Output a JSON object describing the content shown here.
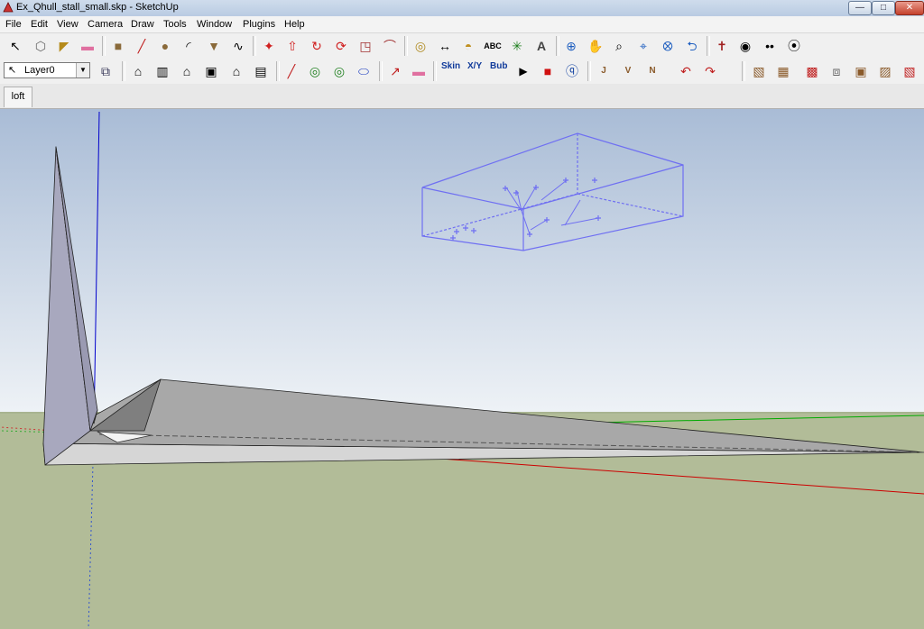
{
  "window": {
    "title": "Ex_Qhull_stall_small.skp - SketchUp",
    "min_glyph": "—",
    "max_glyph": "□",
    "close_glyph": "✕"
  },
  "menu": [
    "File",
    "Edit",
    "View",
    "Camera",
    "Draw",
    "Tools",
    "Window",
    "Plugins",
    "Help"
  ],
  "toolbar": {
    "layer": "Layer0",
    "skin_label": "Skin",
    "xy_label": "X/Y",
    "bub_label": "Bub",
    "play_glyph": "▶",
    "stop_glyph": "■",
    "axis_j": "J",
    "axis_v": "V",
    "axis_n": "N"
  },
  "scene": {
    "tab_label": "loft"
  },
  "colors": {
    "sky_top": "#a9bcd6",
    "sky_bottom": "#eef2f6",
    "ground": "#b2bc98",
    "axis_red": "#cc0000",
    "axis_green": "#00aa00",
    "axis_blue": "#0000cc",
    "bbox": "#6f6ff2"
  },
  "icons": {
    "row1": [
      "select-icon",
      "component-icon",
      "paint-bucket-icon",
      "eraser-icon",
      "rectangle-icon",
      "line-icon",
      "circle-icon",
      "arc-icon",
      "polygon-icon",
      "freehand-icon",
      "move-icon",
      "push-pull-icon",
      "rotate-icon",
      "follow-me-icon",
      "scale-icon",
      "offset-icon",
      "tape-measure-icon",
      "dimension-icon",
      "protractor-icon",
      "text-icon",
      "axes-icon",
      "3d-text-icon",
      "orbit-icon",
      "pan-icon",
      "zoom-icon",
      "zoom-window-icon",
      "zoom-extents-icon",
      "previous-view-icon",
      "position-camera-icon",
      "look-around-icon",
      "walk-icon",
      "section-plane-icon"
    ],
    "row2": [
      "layer-manager-icon",
      "iso-view-icon",
      "right-view-icon",
      "front-view-icon",
      "top-view-icon",
      "back-view-icon",
      "left-view-icon",
      "xray-icon",
      "wireframe-icon",
      "hidden-line-icon",
      "shaded-icon",
      "shaded-texture-icon",
      "monochrome-icon",
      "skin-icon",
      "xy-icon",
      "bubble-icon",
      "play-icon",
      "stop-icon",
      "help-icon",
      "joint-push-pull-icon",
      "vector-push-pull-icon",
      "normal-push-pull-icon",
      "undo-push-icon",
      "redo-push-icon",
      "sandbox-from-contours-icon",
      "sandbox-from-scratch-icon",
      "smoove-icon",
      "stamp-icon",
      "drape-icon",
      "add-detail-icon",
      "flip-edge-icon"
    ]
  }
}
